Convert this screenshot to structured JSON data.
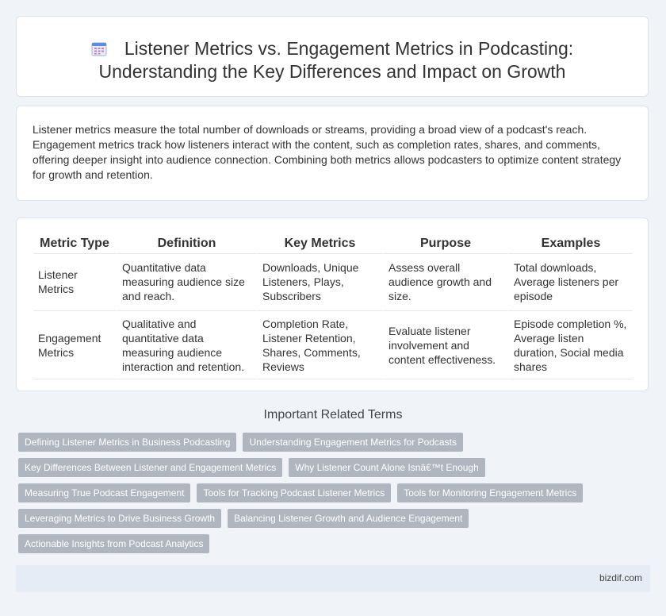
{
  "header": {
    "icon": "calendar-icon",
    "title_line1": "Listener Metrics vs. Engagement Metrics in Podcasting:",
    "title_line2": "Understanding the Key Differences and Impact on Growth"
  },
  "summary": {
    "text": "Listener metrics measure the total number of downloads or streams, providing a broad view of a podcast's reach. Engagement metrics track how listeners interact with the content, such as completion rates, shares, and comments, offering deeper insight into audience connection. Combining both metrics allows podcasters to optimize content strategy for growth and retention."
  },
  "table": {
    "headers": [
      "Metric Type",
      "Definition",
      "Key Metrics",
      "Purpose",
      "Examples"
    ],
    "rows": [
      [
        "Listener Metrics",
        "Quantitative data measuring audience size and reach.",
        "Downloads, Unique Listeners, Plays, Subscribers",
        "Assess overall audience growth and size.",
        "Total downloads, Average listeners per episode"
      ],
      [
        "Engagement Metrics",
        "Qualitative and quantitative data measuring audience interaction and retention.",
        "Completion Rate, Listener Retention, Shares, Comments, Reviews",
        "Evaluate listener involvement and content effectiveness.",
        "Episode completion %, Average listen duration, Social media shares"
      ]
    ]
  },
  "related": {
    "heading": "Important Related Terms",
    "tags": [
      "Defining Listener Metrics in Business Podcasting",
      "Understanding Engagement Metrics for Podcasts",
      "Key Differences Between Listener and Engagement Metrics",
      "Why Listener Count Alone Isnâ€™t Enough",
      "Measuring True Podcast Engagement",
      "Tools for Tracking Podcast Listener Metrics",
      "Tools for Monitoring Engagement Metrics",
      "Leveraging Metrics to Drive Business Growth",
      "Balancing Listener Growth and Audience Engagement",
      "Actionable Insights from Podcast Analytics"
    ]
  },
  "footer": {
    "site": "bizdif.com"
  }
}
